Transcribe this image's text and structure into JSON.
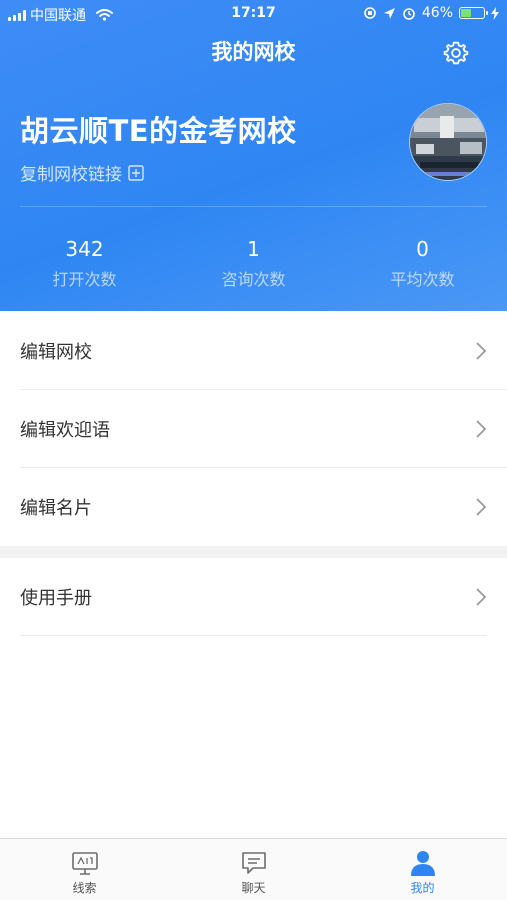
{
  "status_bar": {
    "carrier": "中国联通",
    "time": "17:17",
    "battery_percent": "46%",
    "battery_level": 0.46
  },
  "header": {
    "title": "我的网校",
    "settings_icon": "gear-icon"
  },
  "profile": {
    "school_name": "胡云顺TE的金考网校",
    "copy_link_label": "复制网校链接"
  },
  "stats": [
    {
      "value": "342",
      "label": "打开次数"
    },
    {
      "value": "1",
      "label": "咨询次数"
    },
    {
      "value": "0",
      "label": "平均次数"
    }
  ],
  "menu": [
    {
      "label": "编辑网校"
    },
    {
      "label": "编辑欢迎语"
    },
    {
      "label": "编辑名片"
    },
    {
      "label": "使用手册"
    }
  ],
  "tabbar": [
    {
      "label": "线索",
      "icon": "monitor-icon",
      "active": false
    },
    {
      "label": "聊天",
      "icon": "chat-icon",
      "active": false
    },
    {
      "label": "我的",
      "icon": "user-icon",
      "active": true
    }
  ],
  "colors": {
    "primary": "#2f86f3",
    "battery": "#7ee36a"
  }
}
